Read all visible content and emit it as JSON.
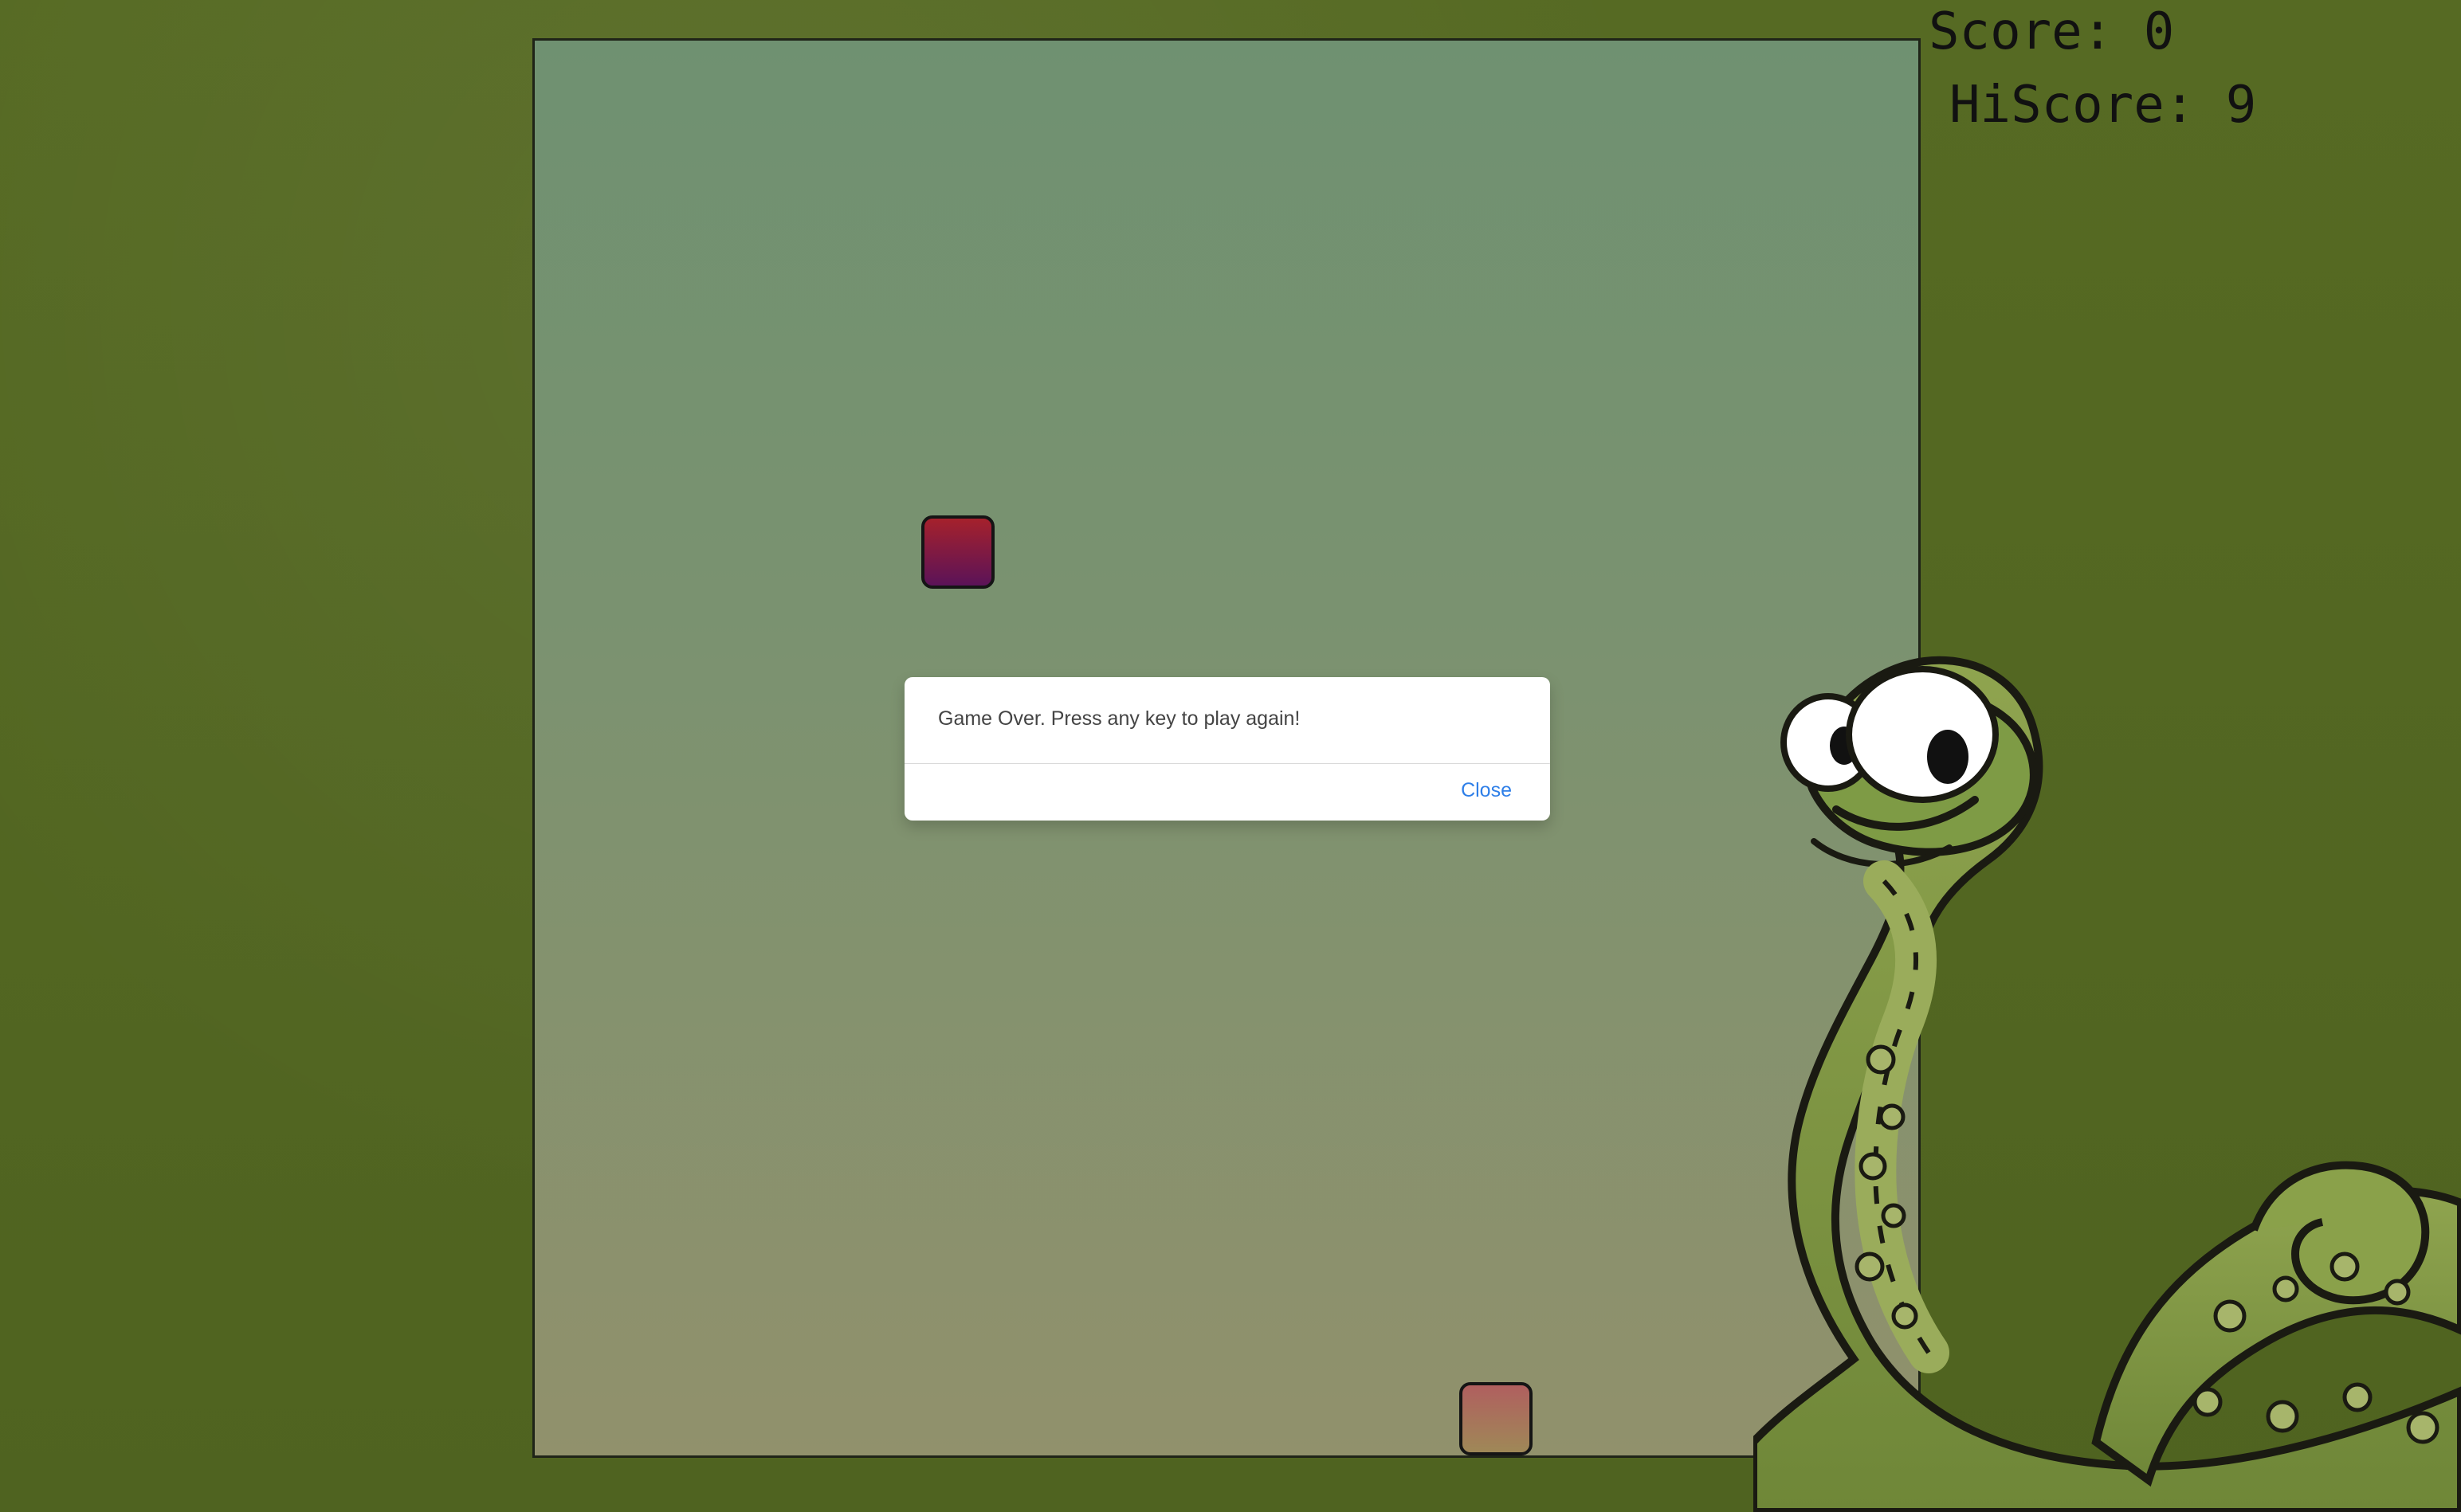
{
  "score": {
    "label": "Score: 0"
  },
  "hiscore": {
    "label": "HiScore: 9"
  },
  "dialog": {
    "message": "Game Over. Press any key to play again!",
    "close_label": "Close"
  },
  "colors": {
    "background": "#546321",
    "board_top": "#6f9171",
    "board_bottom": "#91916c",
    "food_top": "#a5212c",
    "food_bottom": "#5b1358",
    "snake_top": "#b05f5f",
    "snake_bottom": "#9f8857",
    "link": "#2f7fe8"
  },
  "icons": {
    "mascot": "snake-mascot-icon"
  }
}
